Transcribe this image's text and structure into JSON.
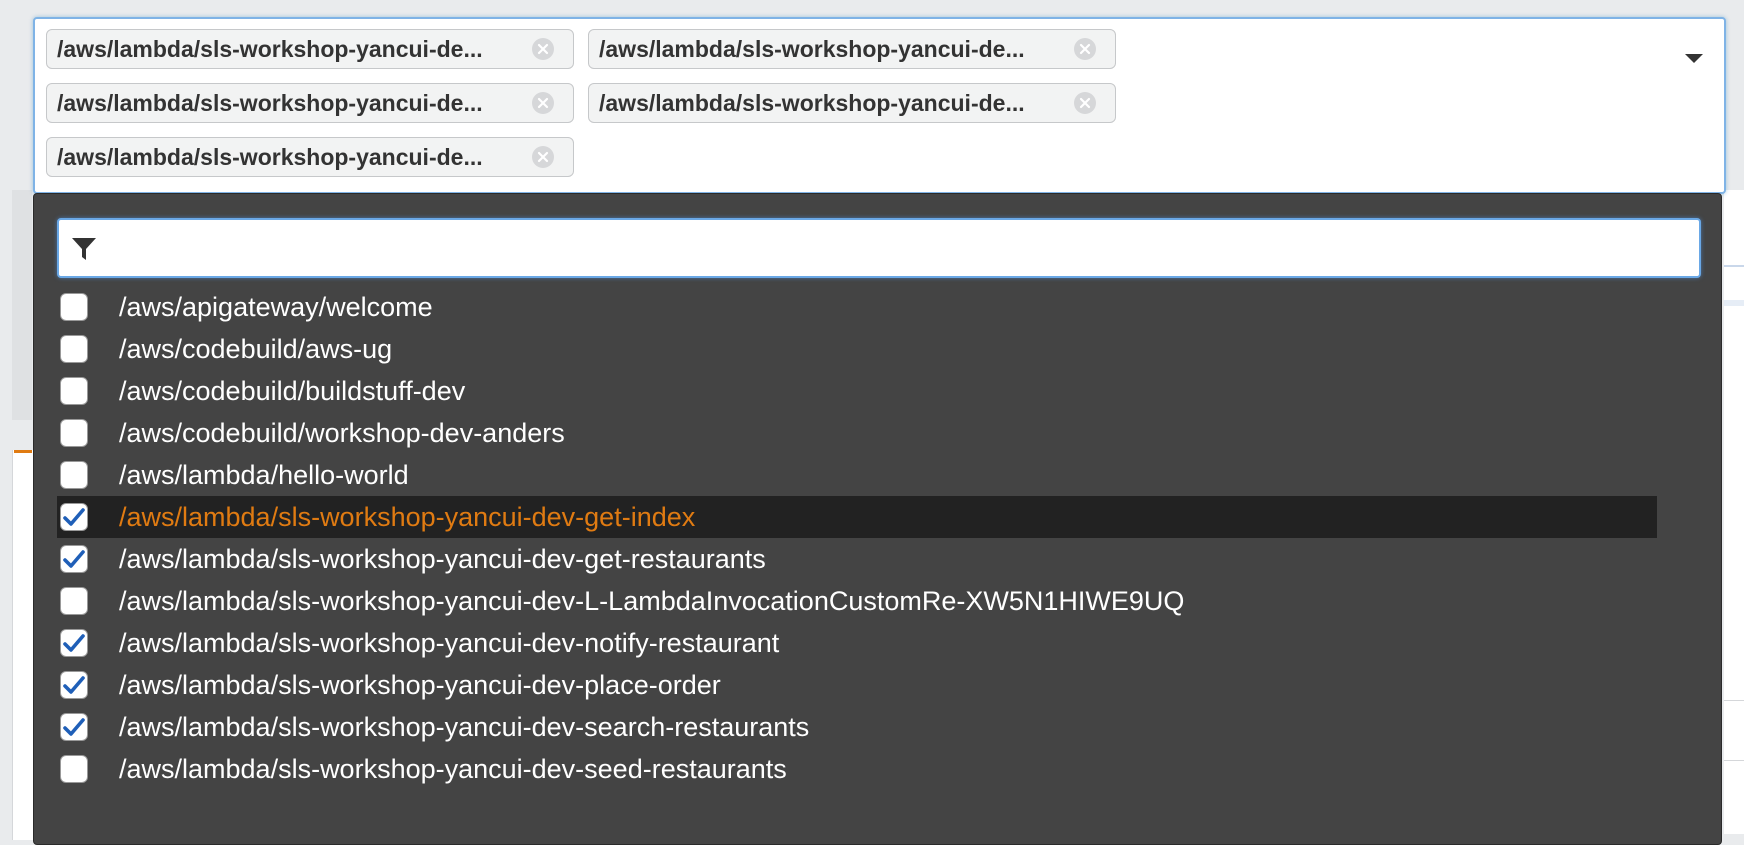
{
  "selected_tokens": [
    {
      "label": "/aws/lambda/sls-workshop-yancui-de..."
    },
    {
      "label": "/aws/lambda/sls-workshop-yancui-de..."
    },
    {
      "label": "/aws/lambda/sls-workshop-yancui-de..."
    },
    {
      "label": "/aws/lambda/sls-workshop-yancui-de..."
    },
    {
      "label": "/aws/lambda/sls-workshop-yancui-de..."
    }
  ],
  "filter": {
    "value": "",
    "icon": "filter-icon"
  },
  "options": [
    {
      "label": "/aws/apigateway/welcome",
      "checked": false
    },
    {
      "label": "/aws/codebuild/aws-ug",
      "checked": false
    },
    {
      "label": "/aws/codebuild/buildstuff-dev",
      "checked": false
    },
    {
      "label": "/aws/codebuild/workshop-dev-anders",
      "checked": false
    },
    {
      "label": "/aws/lambda/hello-world",
      "checked": false
    },
    {
      "label": "/aws/lambda/sls-workshop-yancui-dev-get-index",
      "checked": true,
      "highlighted": true
    },
    {
      "label": "/aws/lambda/sls-workshop-yancui-dev-get-restaurants",
      "checked": true
    },
    {
      "label": "/aws/lambda/sls-workshop-yancui-dev-L-LambdaInvocationCustomRe-XW5N1HIWE9UQ",
      "checked": false
    },
    {
      "label": "/aws/lambda/sls-workshop-yancui-dev-notify-restaurant",
      "checked": true
    },
    {
      "label": "/aws/lambda/sls-workshop-yancui-dev-place-order",
      "checked": true
    },
    {
      "label": "/aws/lambda/sls-workshop-yancui-dev-search-restaurants",
      "checked": true
    },
    {
      "label": "/aws/lambda/sls-workshop-yancui-dev-seed-restaurants",
      "checked": false
    }
  ],
  "colors": {
    "highlight_text": "#e07b12",
    "check": "#1f5fb8",
    "dropdown_bg": "#444444"
  }
}
